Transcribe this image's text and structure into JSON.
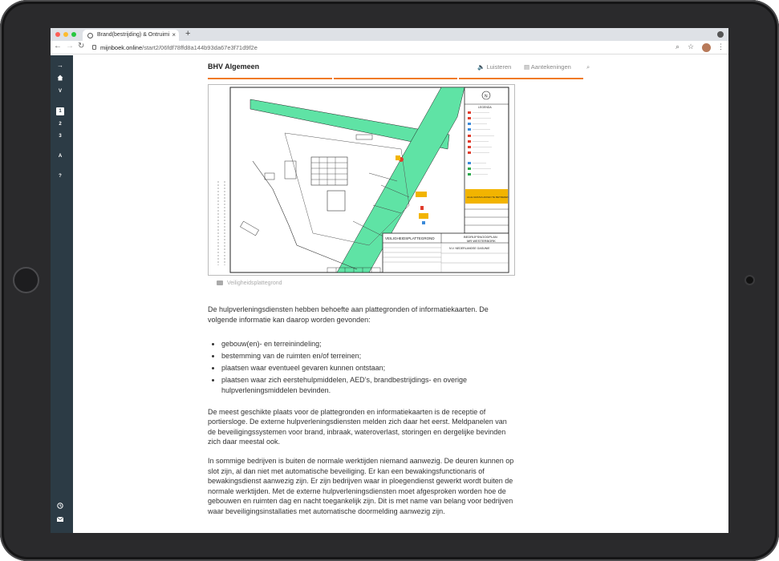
{
  "browser": {
    "tab_title": "Brand(bestrijding) & Ontruimi",
    "tab_close": "×",
    "new_tab": "+",
    "url_domain": "mijnboek.online",
    "url_path": "/start2/06fdf78ffd8a144b93da67e3f71d9f2e"
  },
  "sidebar": {
    "arrow": "→",
    "v": "V",
    "chapters": [
      "1",
      "2",
      "3"
    ],
    "active_chapter": "1",
    "a": "A",
    "help": "?"
  },
  "header": {
    "title": "BHV Algemeen",
    "listen_label": "Luisteren",
    "notes_label": "Aantekeningen"
  },
  "figure": {
    "caption": "Veiligheidsplattegrond",
    "map": {
      "legend_title": "LEGENDA",
      "north": "N",
      "title_left": "VEILIGHEIDSPLATTEGROND",
      "title_right_1": "BEDRIJFSNOODPLAN",
      "title_right_2": "MR WESTERBORK",
      "company": "N.V. NEDERLANDSE GASUNIE",
      "warning_text": "ALLE GRASVLAKKEN TE BETREDEN",
      "assembly_text": "AMSTERDAMSE VERZAMELPLAATS"
    },
    "colors": {
      "green": "#5fe3a5",
      "orange": "#f2b400"
    }
  },
  "article": {
    "p1": "De hulpverleningsdiensten hebben behoefte aan plattegronden of informatiekaarten. De volgende informatie kan daarop worden gevonden:",
    "bullets": [
      "gebouw(en)- en terreinindeling;",
      "bestemming van de ruimten en/of terreinen;",
      "plaatsen waar eventueel gevaren kunnen ontstaan;",
      "plaatsen waar zich eerstehulpmiddelen, AED’s, brandbestrijdings- en overige hulpverleningsmiddelen bevinden."
    ],
    "p2": "De meest geschikte plaats voor de plattegronden en informatiekaarten is de receptie of portiersloge. De externe hulpverleningsdiensten melden zich daar het eerst. Meldpanelen van de beveiligingssystemen voor brand, inbraak, wateroverlast, storingen en dergelijke bevinden zich daar meestal ook.",
    "p3": "In sommige bedrijven is buiten de normale werktijden niemand aanwezig. De deuren kunnen op slot zijn, al dan niet met automatische beveiliging. Er kan een bewakingsfunctionaris of bewakingsdienst aanwezig zijn. Er zijn bedrijven waar in ploegendienst gewerkt wordt buiten de normale werktijden. Met de externe hulpverleningsdiensten moet afgesproken worden hoe de gebouwen en ruimten dag en nacht toegankelijk zijn. Dit is met name van belang voor bedrijven waar beveiligingsinstallaties met automatische doormelding aanwezig zijn."
  }
}
